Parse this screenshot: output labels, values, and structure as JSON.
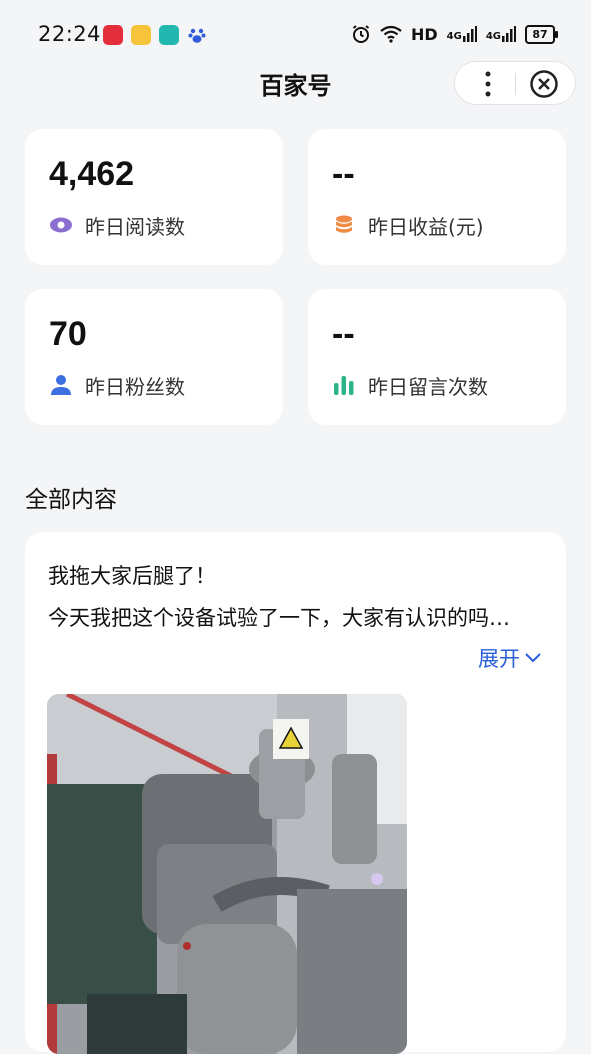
{
  "status_bar": {
    "time": "22:24",
    "network": "HD",
    "signal1": "4G",
    "signal2": "4G",
    "battery": "87"
  },
  "nav": {
    "title": "百家号"
  },
  "stats": [
    {
      "value": "4,462",
      "label": "昨日阅读数",
      "icon": "eye-icon",
      "color": "#8a6fd1"
    },
    {
      "value": "--",
      "label": "昨日收益(元)",
      "icon": "coins-icon",
      "color": "#f08a45"
    },
    {
      "value": "70",
      "label": "昨日粉丝数",
      "icon": "user-icon",
      "color": "#3d6fe0"
    },
    {
      "value": "--",
      "label": "昨日留言次数",
      "icon": "bar-chart-icon",
      "color": "#2bb38a"
    }
  ],
  "section": {
    "title": "全部内容"
  },
  "post": {
    "title": "我拖大家后腿了！",
    "body": "今天我把这个设备试验了一下，大家有认识的吗…",
    "expand_label": "展开"
  }
}
